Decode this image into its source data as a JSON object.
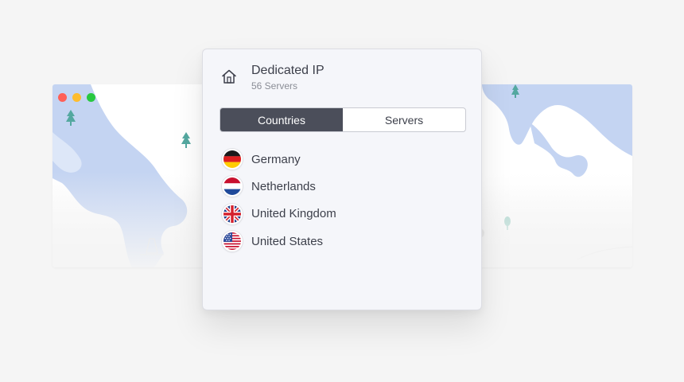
{
  "window": {
    "controls": [
      "close",
      "minimize",
      "zoom"
    ]
  },
  "header": {
    "icon": "home-icon",
    "title": "Dedicated IP",
    "subtitle": "56 Servers"
  },
  "tabs": [
    {
      "label": "Countries",
      "active": true
    },
    {
      "label": "Servers",
      "active": false
    }
  ],
  "countries": [
    {
      "name": "Germany",
      "flag": "germany-flag-icon"
    },
    {
      "name": "Netherlands",
      "flag": "netherlands-flag-icon"
    },
    {
      "name": "United Kingdom",
      "flag": "united-kingdom-flag-icon"
    },
    {
      "name": "United States",
      "flag": "united-states-flag-icon"
    }
  ],
  "colors": {
    "accent_tab": "#4b4e5a",
    "panel_bg": "#f5f6fa",
    "water": "#c4d4f2",
    "tree": "#54a8a0"
  }
}
